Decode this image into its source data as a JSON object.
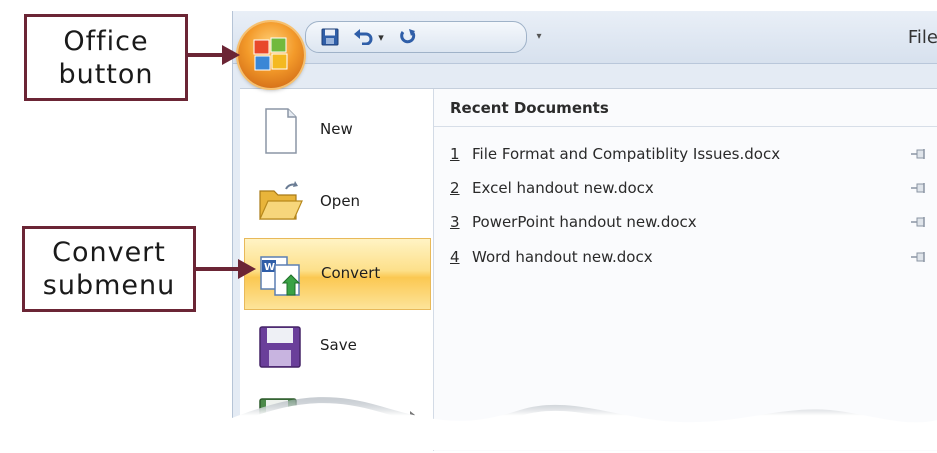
{
  "callouts": {
    "office": [
      "Office",
      "button"
    ],
    "convert": [
      "Convert",
      "submenu"
    ]
  },
  "titlebar": {
    "title_fragment": "File",
    "qat": {
      "save_icon": "floppy-disk-icon",
      "undo_icon": "undo-arrow-icon",
      "redo_icon": "redo-arrow-icon"
    }
  },
  "office_button": {
    "icon": "office-logo-icon"
  },
  "menu": {
    "items": [
      {
        "label": "New",
        "icon": "blank-document-icon"
      },
      {
        "label": "Open",
        "icon": "open-folder-icon"
      },
      {
        "label": "Convert",
        "icon": "convert-document-icon",
        "selected": true
      },
      {
        "label": "Save",
        "icon": "floppy-disk-icon"
      },
      {
        "label": "",
        "icon": "save-as-icon",
        "has_submenu": true
      }
    ]
  },
  "recent": {
    "heading": "Recent Documents",
    "items": [
      {
        "num": "1",
        "name": "File Format and Compatiblity Issues.docx"
      },
      {
        "num": "2",
        "name": "Excel handout new.docx"
      },
      {
        "num": "3",
        "name": "PowerPoint handout new.docx"
      },
      {
        "num": "4",
        "name": "Word handout new.docx"
      }
    ]
  },
  "colors": {
    "callout_border": "#6b2535",
    "arrow": "#6b2535",
    "convert_highlight": "#fbc852",
    "office_orange": "#f39a2a"
  }
}
